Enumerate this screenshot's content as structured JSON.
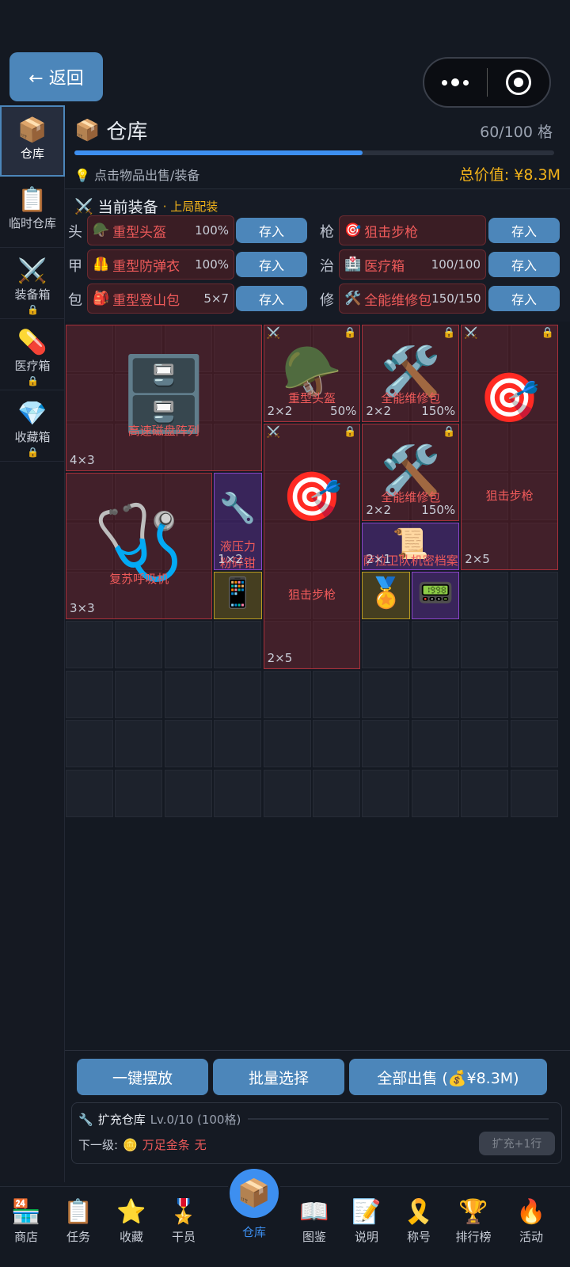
{
  "topbar": {
    "back_label": "← 返回"
  },
  "sidebar": {
    "items": [
      {
        "icon": "📦",
        "label": "仓库",
        "locked": false
      },
      {
        "icon": "📋",
        "label": "临时仓库",
        "locked": false
      },
      {
        "icon": "⚔️",
        "label": "装备箱",
        "locked": true
      },
      {
        "icon": "💊",
        "label": "医疗箱",
        "locked": true
      },
      {
        "icon": "💎",
        "label": "收藏箱",
        "locked": true
      }
    ]
  },
  "warehouse": {
    "title": "仓库",
    "capacity": "60/100 格",
    "fill_fraction": 0.6,
    "hint": "点击物品出售/装备",
    "total_value": "总价值: ¥8.3M"
  },
  "equipment": {
    "title": "当前装备",
    "subtitle": "· 上局配装",
    "store_label": "存入",
    "left": [
      {
        "key": "头",
        "icon": "🪖",
        "name": "重型头盔",
        "value": "100%"
      },
      {
        "key": "甲",
        "icon": "🦺",
        "name": "重型防弹衣",
        "value": "100%"
      },
      {
        "key": "包",
        "icon": "🎒",
        "name": "重型登山包",
        "value": "5×7"
      }
    ],
    "right": [
      {
        "key": "枪",
        "icon": "🎯",
        "name": "狙击步枪",
        "value": ""
      },
      {
        "key": "治",
        "icon": "🏥",
        "name": "医疗箱",
        "value": "100/100"
      },
      {
        "key": "修",
        "icon": "🛠️",
        "name": "全能维修包",
        "value": "150/150"
      }
    ]
  },
  "grid_items": [
    {
      "name": "高速磁盘阵列",
      "size": "4×3",
      "pct": "",
      "icon": "🗄️",
      "locked": false,
      "equip": false
    },
    {
      "name": "重型头盔",
      "size": "2×2",
      "pct": "50%",
      "icon": "🪖",
      "locked": true,
      "equip": true
    },
    {
      "name": "全能维修包",
      "size": "2×2",
      "pct": "150%",
      "icon": "🛠️",
      "locked": true,
      "equip": false
    },
    {
      "name": "狙击步枪",
      "size": "2×5",
      "pct": "",
      "icon": "🎯",
      "locked": true,
      "equip": true
    },
    {
      "name": "狙击步枪",
      "size": "2×5",
      "pct": "",
      "icon": "🎯",
      "locked": true,
      "equip": true
    },
    {
      "name": "全能维修包",
      "size": "2×2",
      "pct": "150%",
      "icon": "🛠️",
      "locked": true,
      "equip": false
    },
    {
      "name": "复苏呼吸机",
      "size": "3×3",
      "pct": "",
      "icon": "🩺",
      "locked": false,
      "equip": false
    },
    {
      "name": "液压力粉碎钳",
      "size": "1×2",
      "pct": "",
      "icon": "🔧",
      "locked": false,
      "equip": false
    },
    {
      "name": "萨拉卫队机密档案",
      "size": "2×1",
      "pct": "",
      "icon": "📜",
      "locked": false,
      "equip": false
    },
    {
      "name": "",
      "size": "",
      "pct": "",
      "icon": "📱",
      "locked": false,
      "equip": false
    },
    {
      "name": "",
      "size": "",
      "pct": "",
      "icon": "🏅",
      "locked": false,
      "equip": false
    },
    {
      "name": "",
      "size": "",
      "pct": "",
      "icon": "📟",
      "locked": false,
      "equip": false
    }
  ],
  "actions": {
    "place_label": "一键摆放",
    "select_label": "批量选择",
    "sell_label": "全部出售 (💰¥8.3M)"
  },
  "expand": {
    "title": "扩充仓库",
    "level": "Lv.0/10 (100格)",
    "next_label": "下一级:",
    "cost_name": "万足金条",
    "cost_value": "无",
    "button_label": "扩充+1行"
  },
  "tabs": [
    {
      "icon": "🏪",
      "label": "商店"
    },
    {
      "icon": "📋",
      "label": "任务"
    },
    {
      "icon": "⭐",
      "label": "收藏"
    },
    {
      "icon": "🎖️",
      "label": "干员"
    },
    {
      "icon": "📦",
      "label": "仓库"
    },
    {
      "icon": "📖",
      "label": "图鉴"
    },
    {
      "icon": "📝",
      "label": "说明"
    },
    {
      "icon": "🎗️",
      "label": "称号"
    },
    {
      "icon": "🏆",
      "label": "排行榜"
    },
    {
      "icon": "🔥",
      "label": "活动"
    }
  ]
}
